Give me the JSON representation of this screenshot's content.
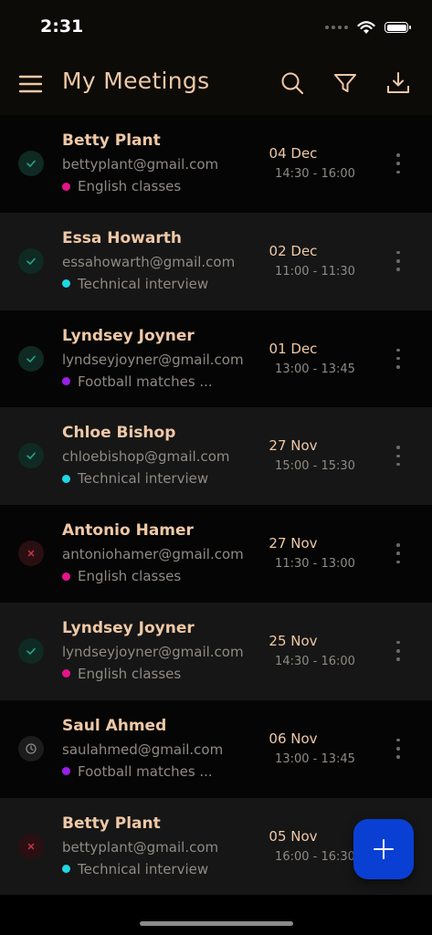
{
  "status_bar": {
    "time": "2:31"
  },
  "header": {
    "title": "My Meetings",
    "icons": [
      "menu-icon",
      "search-icon",
      "filter-icon",
      "download-icon"
    ]
  },
  "colors": {
    "accent_text": "#efc8a6",
    "confirmed": "#2aa58a",
    "cancelled": "#c8354a",
    "pending": "#8a8a8a",
    "tag_english": "#e6148c",
    "tag_technical": "#1fd8e6",
    "tag_football": "#9b1fe6",
    "fab": "#0a3fd3"
  },
  "meetings": [
    {
      "name": "Betty Plant",
      "email": "bettyplant@gmail.com",
      "tag": "English classes",
      "tag_color": "#e6148c",
      "date": "04 Dec",
      "time": "14:30 - 16:00",
      "status": "confirmed"
    },
    {
      "name": "Essa Howarth",
      "email": "essahowarth@gmail.com",
      "tag": "Technical interview",
      "tag_color": "#1fd8e6",
      "date": "02 Dec",
      "time": "11:00 - 11:30",
      "status": "confirmed"
    },
    {
      "name": "Lyndsey Joyner",
      "email": "lyndseyjoyner@gmail.com",
      "tag": "Football matches ...",
      "tag_color": "#9b1fe6",
      "date": "01 Dec",
      "time": "13:00 - 13:45",
      "status": "confirmed"
    },
    {
      "name": "Chloe Bishop",
      "email": "chloebishop@gmail.com",
      "tag": "Technical interview",
      "tag_color": "#1fd8e6",
      "date": "27 Nov",
      "time": "15:00 - 15:30",
      "status": "confirmed"
    },
    {
      "name": "Antonio Hamer",
      "email": "antoniohamer@gmail.com",
      "tag": "English classes",
      "tag_color": "#e6148c",
      "date": "27 Nov",
      "time": "11:30 - 13:00",
      "status": "cancelled"
    },
    {
      "name": "Lyndsey Joyner",
      "email": "lyndseyjoyner@gmail.com",
      "tag": "English classes",
      "tag_color": "#e6148c",
      "date": "25 Nov",
      "time": "14:30 - 16:00",
      "status": "confirmed"
    },
    {
      "name": "Saul Ahmed",
      "email": "saulahmed@gmail.com",
      "tag": "Football matches ...",
      "tag_color": "#9b1fe6",
      "date": "06 Nov",
      "time": "13:00 - 13:45",
      "status": "pending"
    },
    {
      "name": "Betty Plant",
      "email": "bettyplant@gmail.com",
      "tag": "Technical interview",
      "tag_color": "#1fd8e6",
      "date": "05 Nov",
      "time": "16:00 - 16:30",
      "status": "cancelled"
    }
  ],
  "fab": {
    "icon": "plus-icon"
  }
}
